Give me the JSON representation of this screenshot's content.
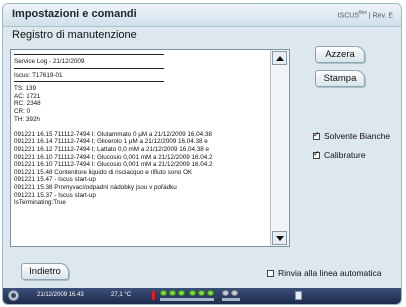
{
  "window": {
    "title": "Impostazioni e comandi",
    "brand": "ISCUS",
    "brand_sup": "flex",
    "revision": "| Rev. E"
  },
  "subtitle": "Registro di manutenzione",
  "log": {
    "header_line": "Service Log - 21/12/2009",
    "serial_line": "Iscus: T17619-01",
    "stats": [
      "TS: 139",
      "AC: 1721",
      "RC: 2348",
      "CR: 0",
      "TH: 392h"
    ],
    "entries": [
      "091221 16.15 711112-7494 I: Glutammato 0 µM a 21/12/2009 16.04.38",
      "091221 16.14 711112-7494 I: Glicerolo 1 µM a 21/12/2009 16.04.38 e",
      "091221 16.12 711112-7494 I: Lattato 0,0 mM a 21/12/2009 16.04.38 e",
      "091221 16.10 711112-7494 I: Glucosio 0,001 mM a 21/12/2009 16.04.2",
      "091221 16.10 711112-7494 I: Glucosio 0,001 mM a 21/12/2009 16.04.2",
      "091221 15.48 Contenitore liquido di risciacquo e rifiuto sono OK",
      "091221 15.47 - Iscus start-up",
      "091221 15.38 Promyvací/odpadní nádobky jsou v pořádku",
      "091221 15.37 - Iscus start-up",
      "IsTerminating:True"
    ]
  },
  "buttons": {
    "reset": "Azzera",
    "print": "Stampa",
    "back": "Indietro"
  },
  "checkboxes": {
    "white_solvent": {
      "label": "Solvente Bianche",
      "checked": true
    },
    "calibrations": {
      "label": "Calibrature",
      "checked": true
    },
    "wrap": {
      "label": "Rinvia alla linea automatica",
      "checked": false
    }
  },
  "statusbar": {
    "datetime": "21/12/2009 16.43",
    "temperature": "27,1 °C"
  }
}
